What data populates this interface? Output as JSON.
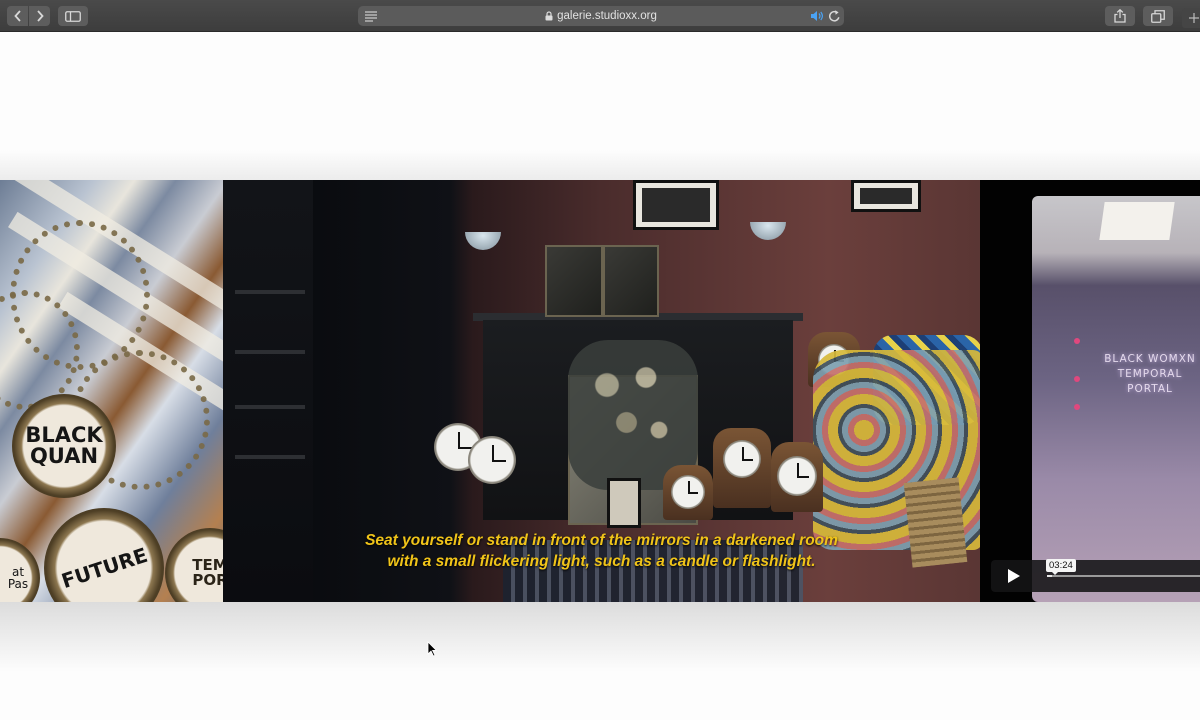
{
  "browser": {
    "url": "galerie.studioxx.org",
    "icons": {
      "back": "chevron-left-icon",
      "forward": "chevron-right-icon",
      "sidebar": "sidebar-icon",
      "reader": "reader-icon",
      "lock": "lock-icon",
      "audio": "speaker-icon",
      "reload": "reload-icon",
      "share": "share-icon",
      "tabs": "tabs-icon",
      "new_tab": "plus-icon"
    }
  },
  "video": {
    "subtitle_line1": "Seat yourself or stand in front of the mirrors in a darkened room",
    "subtitle_line2": "with a small flickering light, such as a candle or flashlight.",
    "subtitle_color": "#f0c419",
    "left_panel": {
      "watch_text_1": "BLACK QUAN",
      "watch_text_2": "FUTURE",
      "watch_text_3": "TEM POR",
      "watch_text_4": "at Pas"
    },
    "right_panel": {
      "screen_title": "BLACK WOMXN TEMPORAL PORTAL"
    },
    "player": {
      "hover_time": "03:24",
      "progress_fraction": 0.03,
      "play_icon": "play-icon"
    }
  },
  "colors": {
    "toolbar": "#444444",
    "page_background": "#fdfdfd",
    "video_background": "#0a0a0a"
  }
}
